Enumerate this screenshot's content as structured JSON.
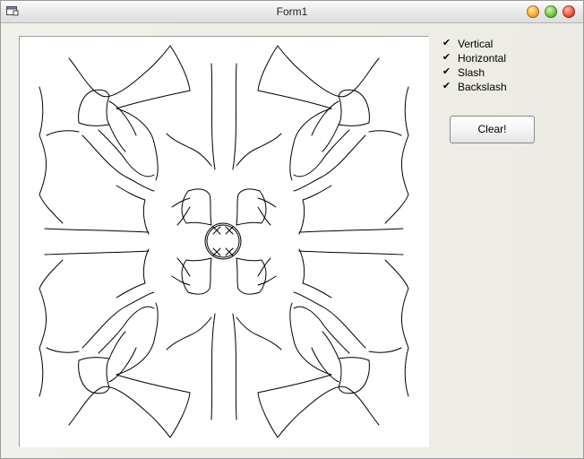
{
  "window": {
    "title": "Form1"
  },
  "icons": {
    "app": "form-window-icon",
    "minimize": "minimize-icon",
    "maximize": "maximize-icon",
    "close": "close-icon"
  },
  "options": [
    {
      "label": "Vertical",
      "checked": true
    },
    {
      "label": "Horizontal",
      "checked": true
    },
    {
      "label": "Slash",
      "checked": true
    },
    {
      "label": "Backslash",
      "checked": true
    }
  ],
  "clear_button": {
    "label": "Clear!"
  },
  "colors": {
    "stroke": "#000000",
    "canvas": "#ffffff",
    "accent_close": "#f04a2b",
    "accent_max": "#6fc232",
    "accent_min": "#f6a52a"
  }
}
